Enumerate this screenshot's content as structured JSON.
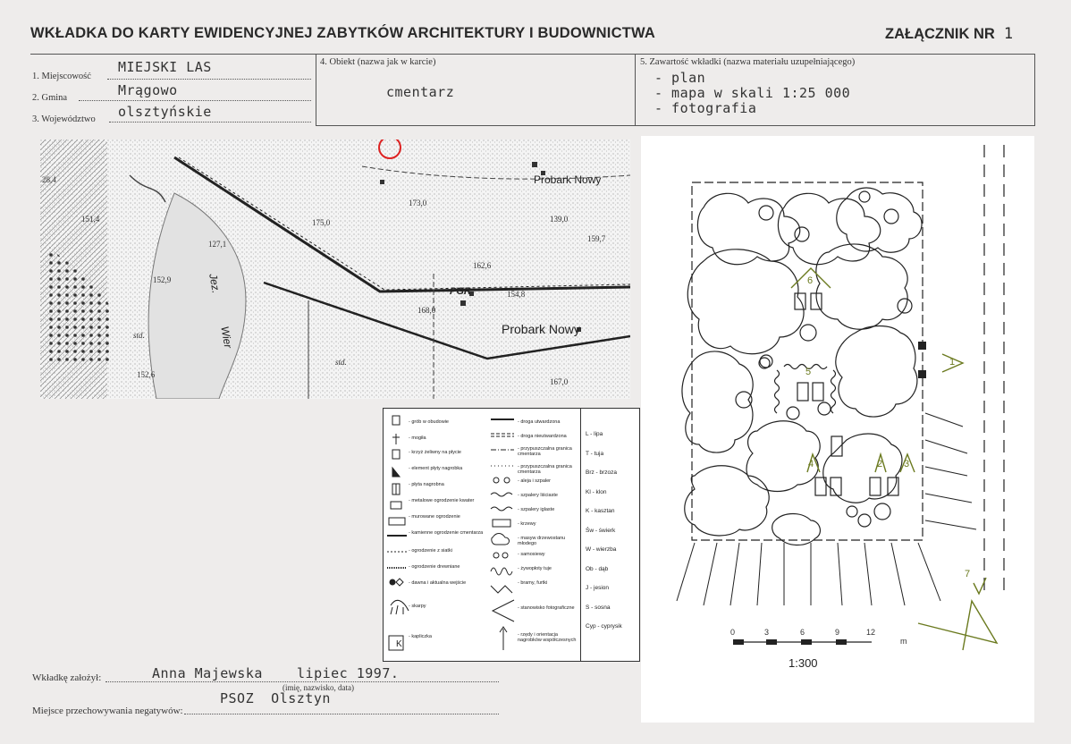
{
  "header": {
    "title": "WKŁADKA DO KARTY EWIDENCYJNEJ ZABYTKÓW ARCHITEKTURY I BUDOWNICTWA",
    "annex_label": "ZAŁĄCZNIK NR",
    "annex_number": "1"
  },
  "fields": {
    "miejscowosc_label": "1. Miejscowość",
    "miejscowosc_value": "MIEJSKI LAS",
    "gmina_label": "2. Gmina",
    "gmina_value": "Mrągowo",
    "wojewodztwo_label": "3. Województwo",
    "wojewodztwo_value": "olsztyńskie",
    "obiekt_label": "4. Obiekt  (nazwa jak w karcie)",
    "obiekt_value": "cmentarz",
    "zawartosc_label": "5. Zawartość wkładki  (nazwa materiału uzupełniającego)",
    "zawartosc_items": [
      "- plan",
      "- mapa w skali 1:25 000",
      "- fotografia"
    ]
  },
  "map": {
    "labels": [
      "Probark Nowy",
      "Probark Nowy",
      "PGR",
      "175,0",
      "173,0",
      "162,6",
      "154,8",
      "168,0",
      "159,7",
      "139,0",
      "151,4",
      "152,9",
      "127,1",
      "152,6",
      "167,0",
      "28,4",
      "std.",
      "std.",
      "Jez.",
      "Wier"
    ]
  },
  "legend": {
    "col1": [
      "- grób w obudowie",
      "- mogiła",
      "- krzyż żeliwny na płycie",
      "- element płyty nagrobka",
      "- płyta nagrobna",
      "- metalowe ogrodzenie kwater",
      "- murowane ogrodzenie",
      "- kamienne ogrodzenie cmentarza",
      "- ogrodzenie z siatki",
      "- ogrodzenie drewniane",
      "- dawna i aktualna wejście",
      "- skarpy",
      "- kapliczka"
    ],
    "col2": [
      "- droga utwardzona",
      "- droga nieutwardzona",
      "- przypuszczalna granica cmentarza",
      "- przypuszczalna granica cmentarza",
      "- aleja i szpaler",
      "- szpalery liściaste",
      "- szpalery iglaste",
      "- krzewy",
      "- masyw drzewostanu młodego",
      "- samosiewy",
      "- żywopłoty tuje",
      "- bramy, furtki",
      "- stanowisko fotograficzne",
      "- rzędy i orientacja nagrobków współczesnych"
    ],
    "trees": [
      "L - lipa",
      "T - tuja",
      "Brz - brzoza",
      "Kl - klon",
      "K - kasztan",
      "Św - świerk",
      "W - wierzba",
      "Ob - dąb",
      "J - jesion",
      "S - sosna",
      "Cyp - cyprysik"
    ],
    "k_symbol": "K"
  },
  "plan": {
    "scale_ticks": [
      "0",
      "3",
      "6",
      "9",
      "12"
    ],
    "scale_unit": "m",
    "scale_ratio": "1:300",
    "grave_numbers": [
      "1",
      "2",
      "3",
      "4",
      "5",
      "6",
      "7"
    ]
  },
  "footer": {
    "founder_label": "Wkładkę założył:",
    "founder_value": "Anna Majewska    lipiec 1997.",
    "founder_hint": "(imię, nazwisko, data)",
    "storage_label": "Miejsce przechowywania negatywów:",
    "storage_value": "PSOZ  Olsztyn"
  }
}
